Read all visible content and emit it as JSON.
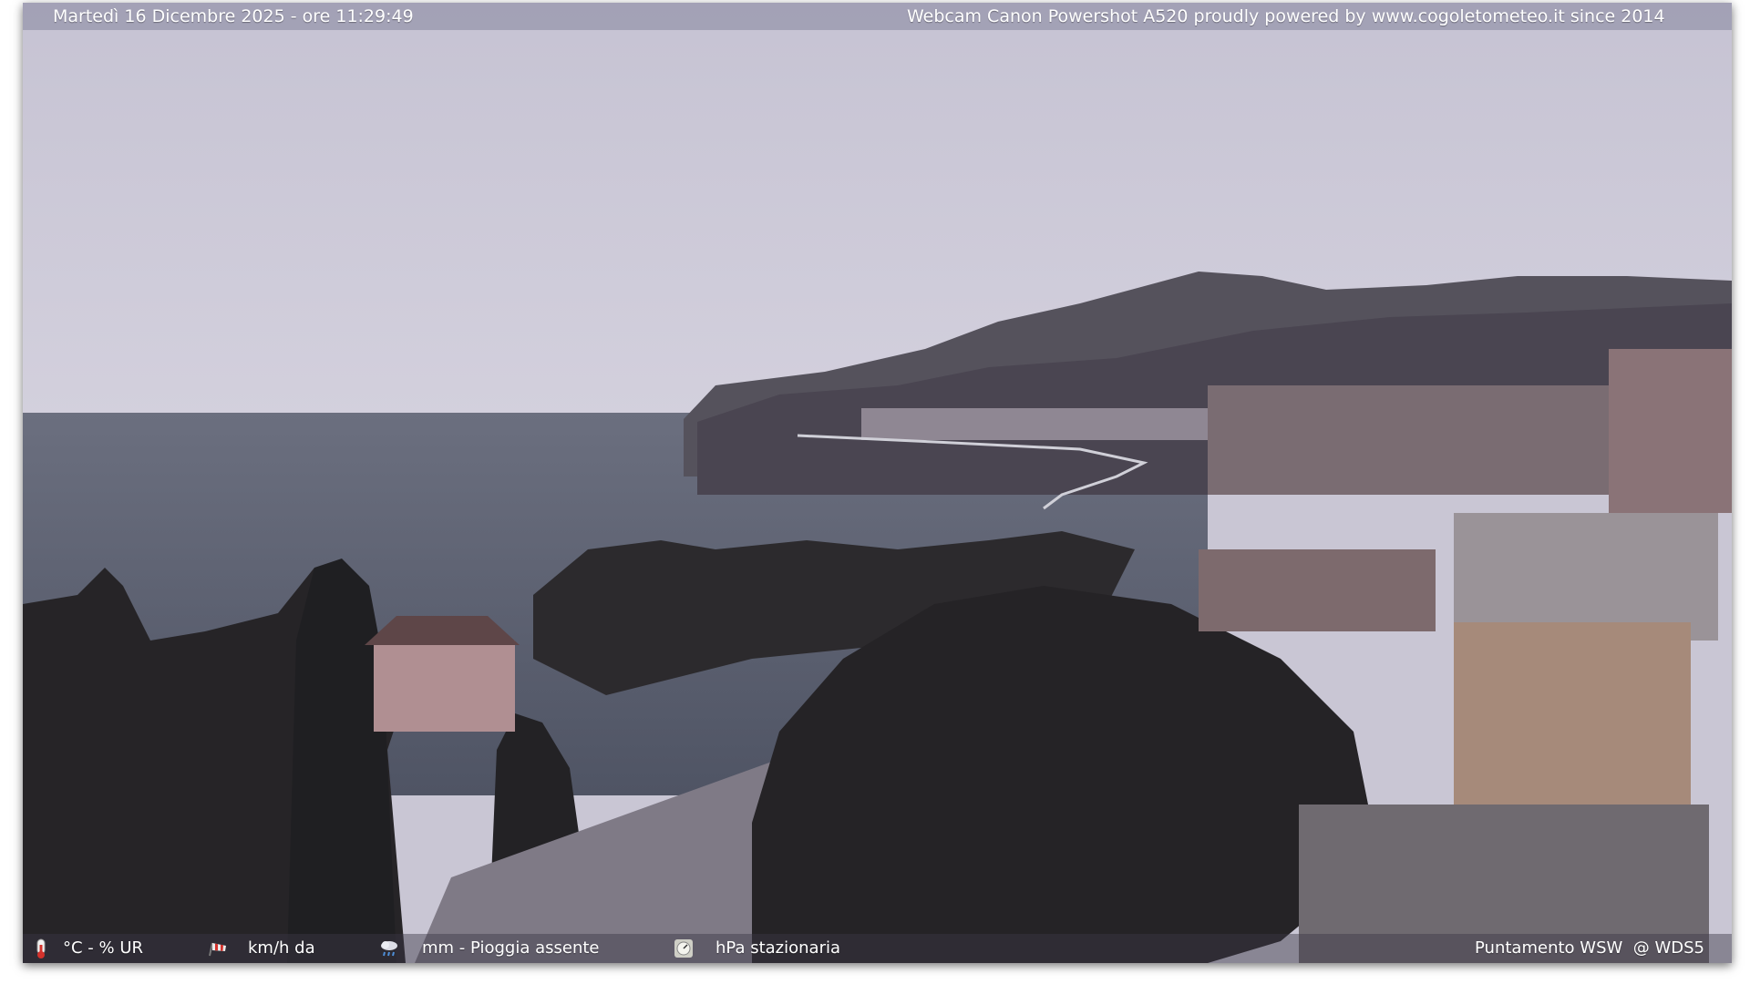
{
  "top_bar": {
    "datetime": "Martedì 16 Dicembre 2025 - ore 11:29:49",
    "credit": "Webcam Canon Powershot A520 proudly powered by www.cogoletometeo.it since 2014"
  },
  "bottom_bar": {
    "temperature_humidity": "°C - % UR",
    "wind": "km/h da",
    "rain": "mm - Pioggia assente",
    "pressure": "hPa stazionaria",
    "pointing": "Puntamento WSW  @ WDS5",
    "icons": [
      "thermometer-icon",
      "windsock-icon",
      "rain-cloud-icon",
      "barometer-icon"
    ]
  },
  "colors": {
    "sky": "#c9c6d6",
    "sea": "#5b6070",
    "hills": "#4a4650",
    "trees": "#2a2a2c"
  }
}
